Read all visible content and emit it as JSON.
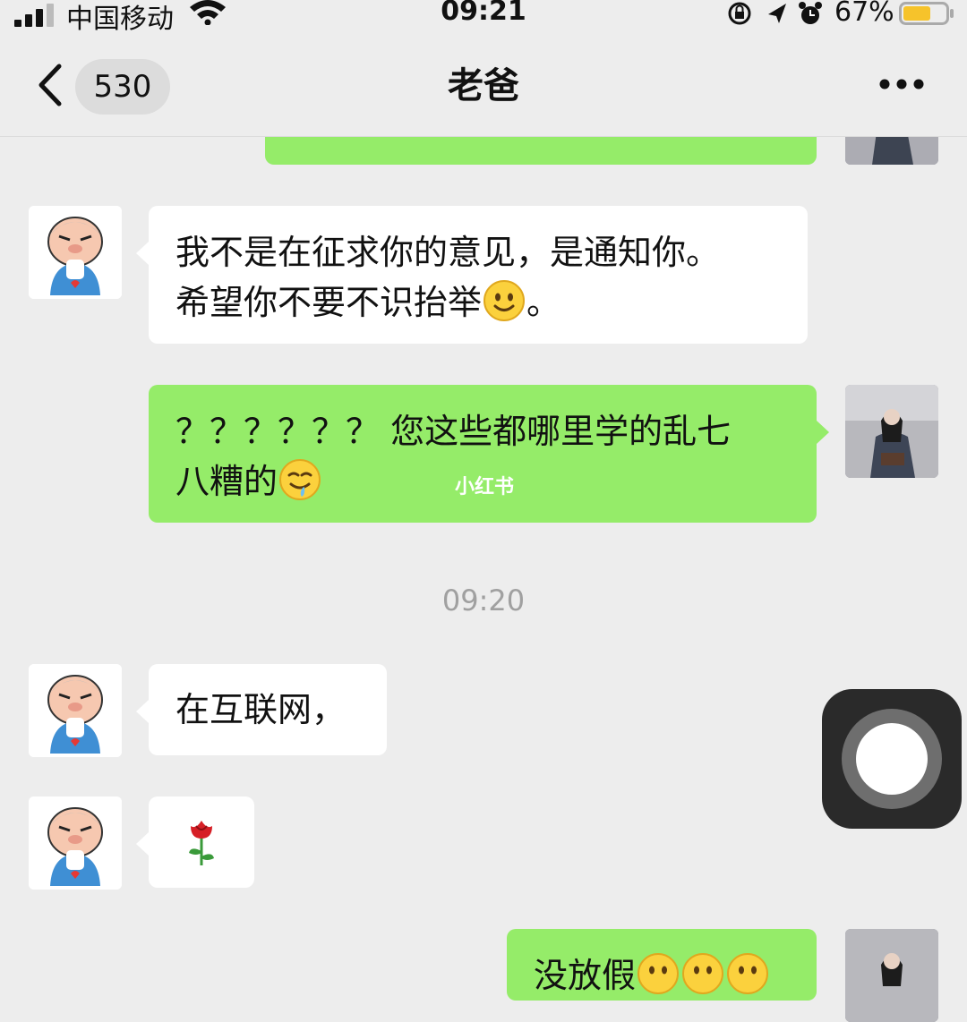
{
  "status_bar": {
    "carrier": "中国移动",
    "time": "09:21",
    "battery": "67%"
  },
  "nav": {
    "unread_count": "530",
    "title": "老爸"
  },
  "messages": [
    {
      "from": "me",
      "text_partial": ""
    },
    {
      "from": "dad",
      "line1": "我不是在征求你的意见，是通知你。",
      "line2_a": "希望你不要不识抬举",
      "line2_b": "。",
      "emoji": "smile-emoji"
    },
    {
      "from": "me",
      "line1": "？？？？？？ 您这些都哪里学的乱七",
      "line2": "八糟的",
      "emoji": "drooling-emoji"
    },
    {
      "timestamp": "09:20"
    },
    {
      "from": "dad",
      "text": "在互联网，"
    },
    {
      "from": "dad",
      "sticker": "rose-emoji"
    },
    {
      "from": "me",
      "text_partial": "没放假"
    }
  ],
  "watermark": "小红书",
  "colors": {
    "background": "#ededed",
    "my_bubble": "#95ec69",
    "their_bubble": "#ffffff",
    "timestamp": "#a0a0a0"
  }
}
